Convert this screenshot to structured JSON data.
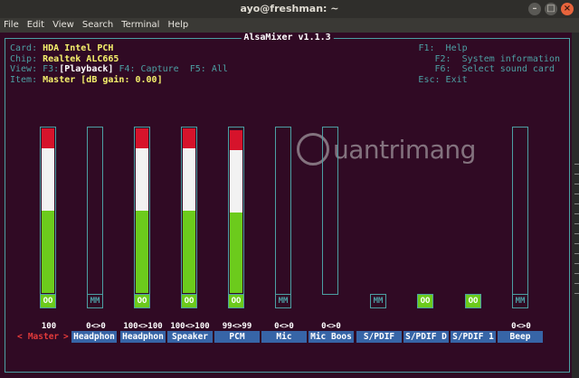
{
  "window": {
    "title": "ayo@freshman: ~"
  },
  "menubar": [
    "File",
    "Edit",
    "View",
    "Search",
    "Terminal",
    "Help"
  ],
  "mixer": {
    "title": "AlsaMixer v1.1.3",
    "card_label": "Card:",
    "card_value": "HDA Intel PCH",
    "chip_label": "Chip:",
    "chip_value": "Realtek ALC665",
    "view_label": "View:",
    "view_f3": "F3:",
    "view_playback": "[Playback]",
    "view_capture": "F4: Capture",
    "view_all": "F5: All",
    "item_label": "Item:",
    "item_value": "Master [dB gain: 0.00]"
  },
  "help": [
    {
      "key": "F1:",
      "text": "Help"
    },
    {
      "key": "F2:",
      "text": "System information"
    },
    {
      "key": "F6:",
      "text": "Select sound card"
    },
    {
      "key": "Esc:",
      "text": "Exit"
    }
  ],
  "channels": [
    {
      "name": "Master",
      "value": "100",
      "mute": "OO",
      "level": 1.0,
      "red_pct": 0.2,
      "muted": false,
      "selected": true
    },
    {
      "name": "Headphon",
      "value": "0<>0",
      "mute": "MM",
      "level": 0,
      "muted": true
    },
    {
      "name": "Headphon",
      "value": "100<>100",
      "mute": "OO",
      "level": 1.0,
      "muted": false
    },
    {
      "name": "Speaker",
      "value": "100<>100",
      "mute": "OO",
      "level": 1.0,
      "muted": false
    },
    {
      "name": "PCM",
      "value": "99<>99",
      "mute": "OO",
      "level": 0.99,
      "muted": false
    },
    {
      "name": "Mic",
      "value": "0<>0",
      "mute": "MM",
      "level": 0,
      "muted": true
    },
    {
      "name": "Mic Boos",
      "value": "0<>0",
      "mute": "",
      "level": 0,
      "muted": false
    },
    {
      "name": "S/PDIF",
      "value": "",
      "mute": "MM",
      "level": null,
      "muted": true
    },
    {
      "name": "S/PDIF D",
      "value": "",
      "mute": "OO",
      "level": null,
      "muted": false
    },
    {
      "name": "S/PDIF 1",
      "value": "",
      "mute": "OO",
      "level": null,
      "muted": false
    },
    {
      "name": "Beep",
      "value": "0<>0",
      "mute": "MM",
      "level": 0,
      "muted": true
    }
  ],
  "watermark": "uantrimang",
  "colors": {
    "terminal_bg": "#300a24",
    "frame": "#4c9fa3",
    "accent_yellow": "#f6f16c",
    "name_bg": "#3765a7",
    "level_green": "#6ccb1c",
    "level_red": "#d6132b"
  }
}
